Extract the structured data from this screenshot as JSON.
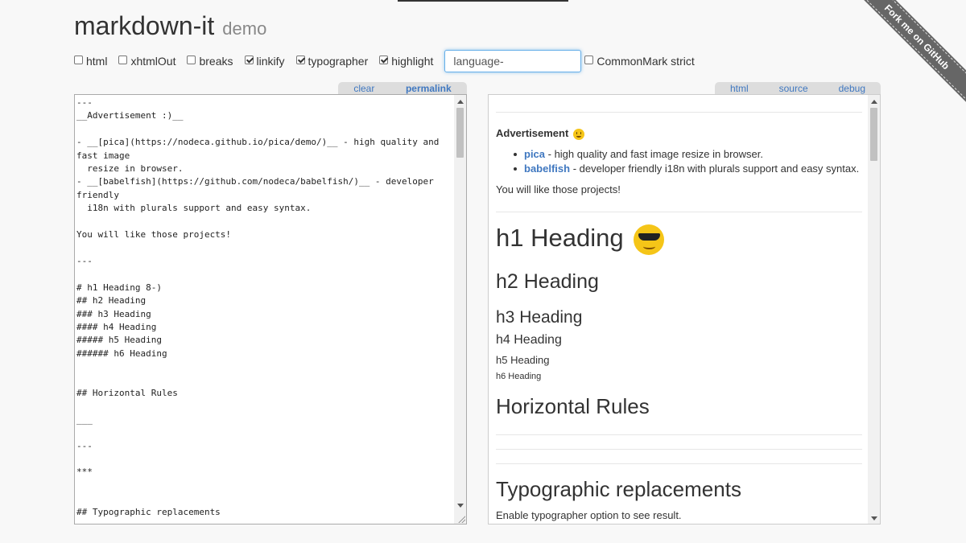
{
  "header": {
    "title": "markdown-it",
    "subtitle": "demo"
  },
  "options": {
    "html": "html",
    "xhtmlOut": "xhtmlOut",
    "breaks": "breaks",
    "linkify": "linkify",
    "typographer": "typographer",
    "highlight": "highlight",
    "language_value": "language-",
    "commonmark": "CommonMark strict"
  },
  "ribbon": "Fork me on GitHub",
  "source_tabs": {
    "clear": "clear",
    "permalink": "permalink"
  },
  "result_tabs": {
    "html": "html",
    "source": "source",
    "debug": "debug"
  },
  "editor": {
    "text": "---\n__Advertisement :)__\n\n- __[pica](https://nodeca.github.io/pica/demo/)__ - high quality and fast image\n  resize in browser.\n- __[babelfish](https://github.com/nodeca/babelfish/)__ - developer friendly\n  i18n with plurals support and easy syntax.\n\nYou will like those projects!\n\n---\n\n# h1 Heading 8-)\n## h2 Heading\n### h3 Heading\n#### h4 Heading\n##### h5 Heading\n###### h6 Heading\n\n\n## Horizontal Rules\n\n___\n\n---\n\n***\n\n\n## Typographic replacements"
  },
  "preview": {
    "ad_title": "Advertisement",
    "item1_link": "pica",
    "item1_text": " - high quality and fast image resize in browser.",
    "item2_link": "babelfish",
    "item2_text": " - developer friendly i18n with plurals support and easy syntax.",
    "projects": "You will like those projects!",
    "h1": "h1 Heading",
    "h2": "h2 Heading",
    "h3": "h3 Heading",
    "h4": "h4 Heading",
    "h5": "h5 Heading",
    "h6": "h6 Heading",
    "hr_title": "Horizontal Rules",
    "typo_title": "Typographic replacements",
    "typo_text": "Enable typographer option to see result."
  }
}
